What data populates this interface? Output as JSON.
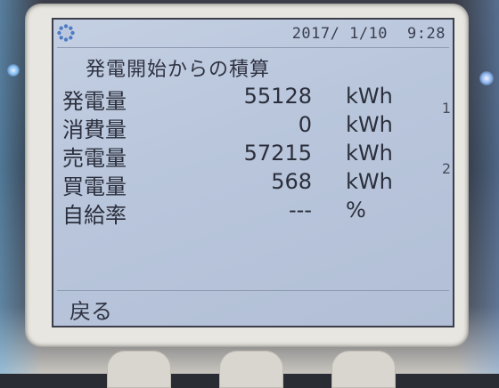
{
  "status_bar": {
    "date": "2017/ 1/10",
    "time": "9:28",
    "icon": "gear-icon"
  },
  "title": "発電開始からの積算",
  "rows": [
    {
      "label": "発電量",
      "value": "55128",
      "unit": "kWh"
    },
    {
      "label": "消費量",
      "value": "0",
      "unit": "kWh"
    },
    {
      "label": "売電量",
      "value": "57215",
      "unit": "kWh"
    },
    {
      "label": "買電量",
      "value": "568",
      "unit": "kWh"
    },
    {
      "label": "自給率",
      "value": "---",
      "unit": "%"
    }
  ],
  "footer": {
    "back_label": "戻る"
  },
  "side_markers": [
    "1",
    "2"
  ],
  "colors": {
    "screen": "#b9c6dc",
    "text": "#2b2f3c",
    "bezel": "#e8e6e0"
  }
}
